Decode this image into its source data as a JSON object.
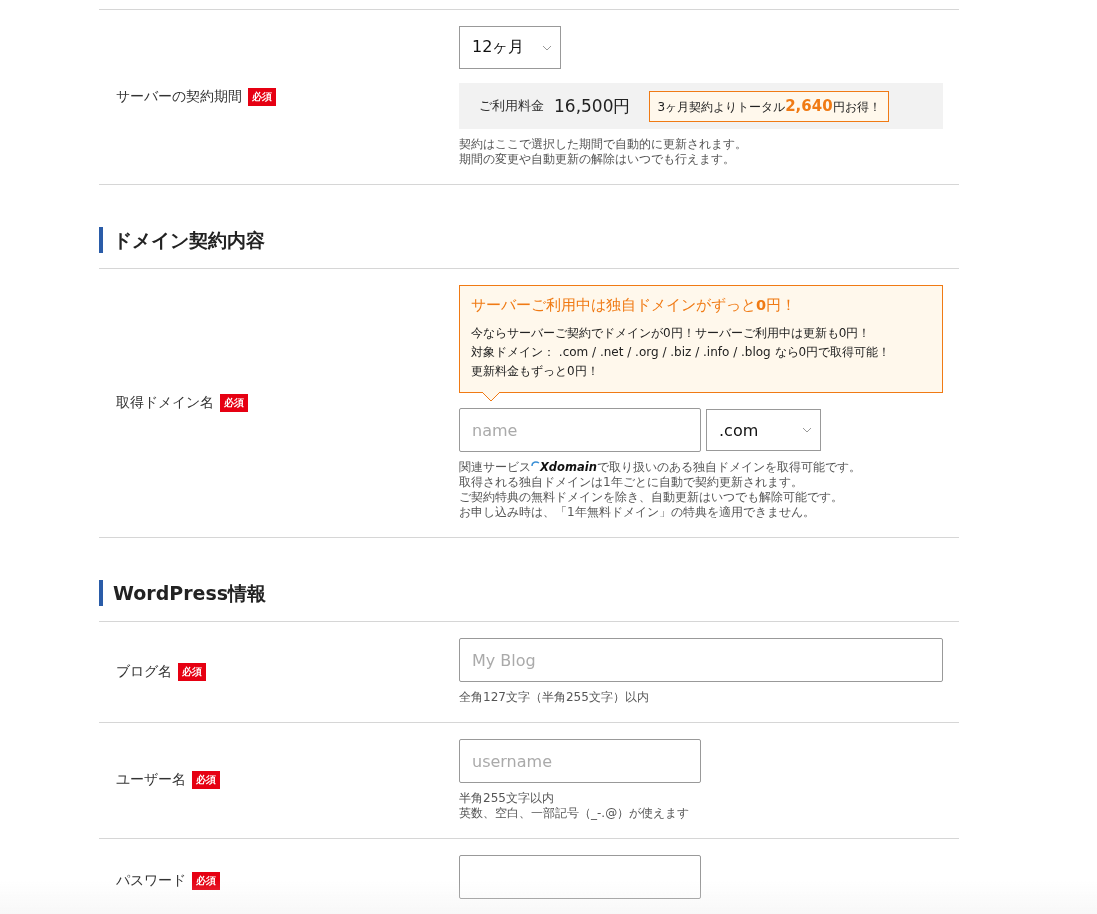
{
  "sections": [
    {
      "rows": [
        {
          "kind": "plan",
          "label": "サーバーの契約期間",
          "required": "必須",
          "select": {
            "value": "12ヶ月"
          },
          "price": {
            "label": "ご利用料金",
            "amount": "16,500円",
            "savings": "3ヶ月契約よりトータル**2,640**円お得！"
          },
          "notes": [
            "契約はここで選択した期間で自動的に更新されます。",
            "期間の変更や自動更新の解除はいつでも行えます。"
          ]
        }
      ]
    },
    {
      "heading": "ドメイン契約内容",
      "rows": [
        {
          "kind": "domain",
          "label": "取得ドメイン名",
          "required": "必須",
          "promo": {
            "title": "サーバーご利用中は独自ドメインがずっと**0**円！",
            "lines": [
              "今ならサーバーご契約でドメインが0円！サーバーご利用中は更新も0円！",
              "対象ドメイン： .com / .net / .org / .biz / .info / .blog なら0円で取得可能！",
              "更新料金もずっと0円！"
            ]
          },
          "field": {
            "placeholder": "name"
          },
          "select": {
            "value": ".com"
          },
          "service_note": {
            "before": "関連サービス",
            "logo": "Xdomain",
            "after": "で取り扱いのある独自ドメインを取得可能です。"
          },
          "notes": [
            "取得される独自ドメインは1年ごとに自動で契約更新されます。",
            "ご契約特典の無料ドメインを除き、自動更新はいつでも解除可能です。",
            "お申し込み時は、「1年無料ドメイン」の特典を適用できません。"
          ]
        }
      ]
    },
    {
      "heading": "WordPress情報",
      "rows": [
        {
          "kind": "text",
          "label": "ブログ名",
          "required": "必須",
          "field": {
            "kind": "full",
            "placeholder": "My Blog"
          },
          "notes": [
            "全角127文字（半角255文字）以内"
          ]
        },
        {
          "kind": "text",
          "label": "ユーザー名",
          "required": "必須",
          "field": {
            "kind": "half",
            "placeholder": "username"
          },
          "notes": [
            "半角255文字以内",
            "英数、空白、一部記号（_-.@）が使えます"
          ]
        },
        {
          "kind": "text",
          "label": "パスワード",
          "required": "必須",
          "field": {
            "kind": "half"
          }
        }
      ]
    }
  ]
}
